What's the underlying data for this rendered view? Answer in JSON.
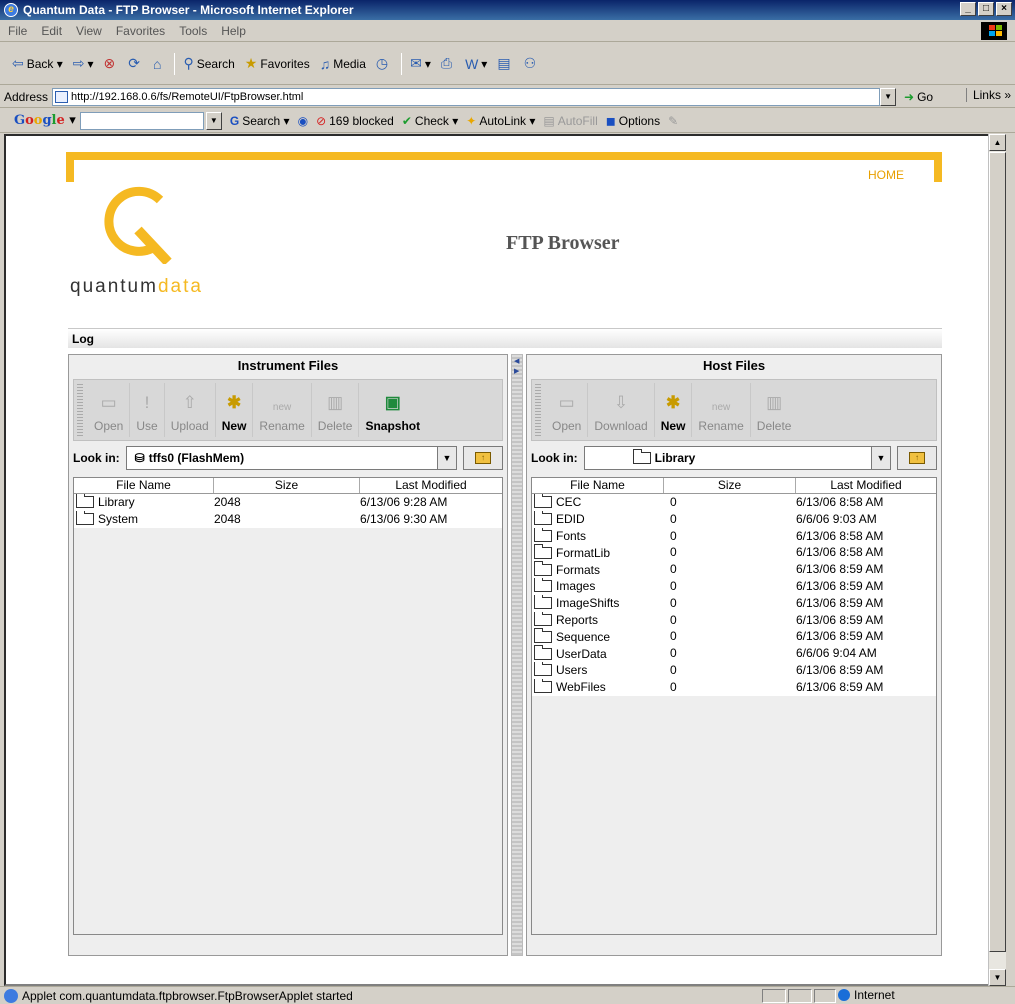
{
  "window": {
    "title": "Quantum Data - FTP Browser - Microsoft Internet Explorer"
  },
  "menu": [
    "File",
    "Edit",
    "View",
    "Favorites",
    "Tools",
    "Help"
  ],
  "toolbar": {
    "back": "Back",
    "search": "Search",
    "favorites": "Favorites",
    "media": "Media"
  },
  "address": {
    "label": "Address",
    "url": "http://192.168.0.6/fs/RemoteUI/FtpBrowser.html",
    "go": "Go",
    "links": "Links"
  },
  "googlebar": {
    "search": "Search",
    "blocked": "169 blocked",
    "check": "Check",
    "autolink": "AutoLink",
    "autofill": "AutoFill",
    "options": "Options"
  },
  "page": {
    "home": "HOME",
    "logo_left": "quantum",
    "logo_right": "data",
    "title": "FTP Browser",
    "log": "Log"
  },
  "instrument": {
    "title": "Instrument Files",
    "tools": [
      "Open",
      "Use",
      "Upload",
      "New",
      "Rename",
      "Delete",
      "Snapshot"
    ],
    "look_in_label": "Look in:",
    "look_in_value": "tffs0  (FlashMem)",
    "columns": [
      "File Name",
      "Size",
      "Last Modified"
    ],
    "files": [
      {
        "name": "Library",
        "size": "2048",
        "modified": "6/13/06 9:28 AM"
      },
      {
        "name": "System",
        "size": "2048",
        "modified": "6/13/06 9:30 AM"
      }
    ]
  },
  "host": {
    "title": "Host Files",
    "tools": [
      "Open",
      "Download",
      "New",
      "Rename",
      "Delete"
    ],
    "look_in_label": "Look in:",
    "look_in_value": "Library",
    "columns": [
      "File Name",
      "Size",
      "Last Modified"
    ],
    "files": [
      {
        "name": "CEC",
        "size": "0",
        "modified": "6/13/06 8:58 AM"
      },
      {
        "name": "EDID",
        "size": "0",
        "modified": "6/6/06 9:03 AM"
      },
      {
        "name": "Fonts",
        "size": "0",
        "modified": "6/13/06 8:58 AM"
      },
      {
        "name": "FormatLib",
        "size": "0",
        "modified": "6/13/06 8:58 AM"
      },
      {
        "name": "Formats",
        "size": "0",
        "modified": "6/13/06 8:59 AM"
      },
      {
        "name": "Images",
        "size": "0",
        "modified": "6/13/06 8:59 AM"
      },
      {
        "name": "ImageShifts",
        "size": "0",
        "modified": "6/13/06 8:59 AM"
      },
      {
        "name": "Reports",
        "size": "0",
        "modified": "6/13/06 8:59 AM"
      },
      {
        "name": "Sequence",
        "size": "0",
        "modified": "6/13/06 8:59 AM"
      },
      {
        "name": "UserData",
        "size": "0",
        "modified": "6/6/06 9:04 AM"
      },
      {
        "name": "Users",
        "size": "0",
        "modified": "6/13/06 8:59 AM"
      },
      {
        "name": "WebFiles",
        "size": "0",
        "modified": "6/13/06 8:59 AM"
      }
    ]
  },
  "status": {
    "text": "Applet com.quantumdata.ftpbrowser.FtpBrowserApplet started",
    "zone": "Internet"
  },
  "colors": {
    "accent": "#f5b922",
    "title_bar": "#0a246a"
  }
}
